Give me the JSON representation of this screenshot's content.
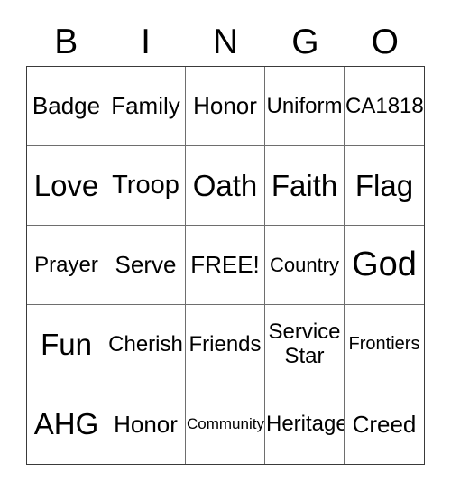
{
  "card": {
    "header_letters": [
      "B",
      "I",
      "N",
      "G",
      "O"
    ],
    "columns": 5,
    "rows": 5,
    "free_space_label": "FREE!",
    "colors": {
      "background": "#ffffff",
      "text": "#000000",
      "grid_line": "#6e6e6e",
      "outer_border": "#3a3a3a"
    },
    "cells": [
      {
        "text": "Badge",
        "size": "fs-ml"
      },
      {
        "text": "Family",
        "size": "fs-ml"
      },
      {
        "text": "Honor",
        "size": "fs-ml"
      },
      {
        "text": "Uniform",
        "size": "fs-m"
      },
      {
        "text": "CA1818",
        "size": "fs-m"
      },
      {
        "text": "Love",
        "size": "fs-xl"
      },
      {
        "text": "Troop",
        "size": "fs-l"
      },
      {
        "text": "Oath",
        "size": "fs-xl"
      },
      {
        "text": "Faith",
        "size": "fs-xl"
      },
      {
        "text": "Flag",
        "size": "fs-xl"
      },
      {
        "text": "Prayer",
        "size": "fs-m"
      },
      {
        "text": "Serve",
        "size": "fs-ml"
      },
      {
        "text": "FREE!",
        "size": "fs-ml"
      },
      {
        "text": "Country",
        "size": "fs-sm"
      },
      {
        "text": "God",
        "size": "fs-xxl"
      },
      {
        "text": "Fun",
        "size": "fs-xl"
      },
      {
        "text": "Cherish",
        "size": "fs-m"
      },
      {
        "text": "Friends",
        "size": "fs-m"
      },
      {
        "text": "Service Star",
        "size": "fs-m",
        "multiline": true
      },
      {
        "text": "Frontiers",
        "size": "fs-s"
      },
      {
        "text": "AHG",
        "size": "fs-xl"
      },
      {
        "text": "Honor",
        "size": "fs-ml"
      },
      {
        "text": "Community",
        "size": "fs-xs"
      },
      {
        "text": "Heritage",
        "size": "fs-m"
      },
      {
        "text": "Creed",
        "size": "fs-ml"
      }
    ]
  }
}
